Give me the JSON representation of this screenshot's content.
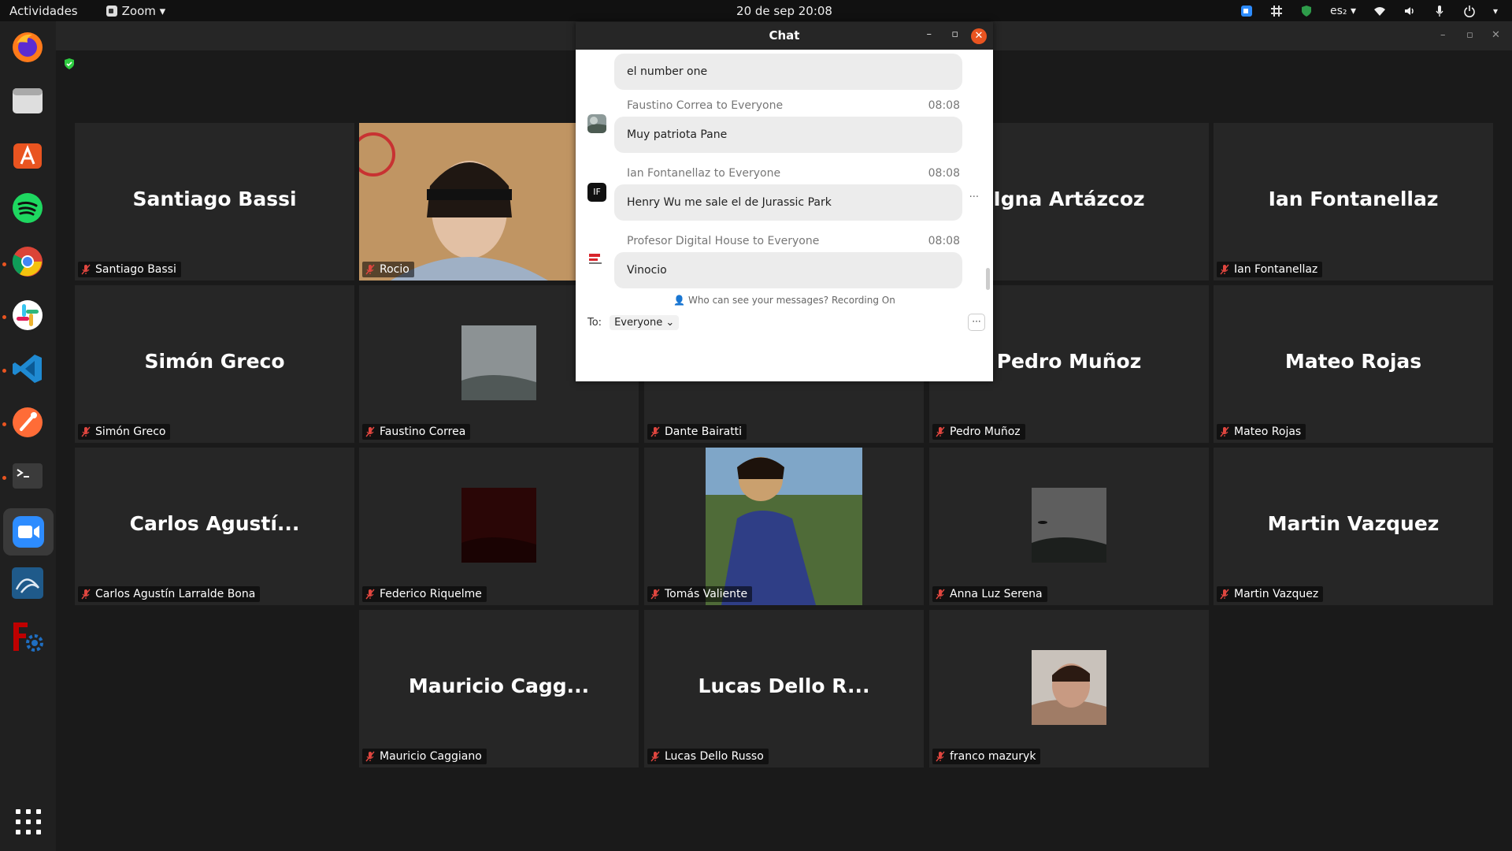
{
  "topbar": {
    "activities": "Actividades",
    "app_menu": "Zoom ▾",
    "clock": "20 de sep  20:08",
    "lang": "es₂ ▾"
  },
  "chat": {
    "title": "Chat",
    "messages": [
      {
        "sender": "",
        "time": "",
        "text": "el number one"
      },
      {
        "sender": "Faustino Correa to Everyone",
        "time": "08:08",
        "text": "Muy patriota Pane"
      },
      {
        "sender": "Ian Fontanellaz to Everyone",
        "time": "08:08",
        "text": "Henry Wu me sale el de Jurassic Park",
        "avatar_initials": "IF"
      },
      {
        "sender": "Profesor Digital House to Everyone",
        "time": "08:08",
        "text": "Vinocio"
      }
    ],
    "notice": "Who can see your messages? Recording On",
    "to_label": "To:",
    "to_value": "Everyone ⌄",
    "more": "···",
    "hover_more": "···"
  },
  "tiles": [
    {
      "big": "Santiago Bassi",
      "label": "Santiago Bassi"
    },
    {
      "big": "",
      "label": "Rocio"
    },
    {
      "big": "",
      "label": ""
    },
    {
      "big": "Igna Artázcoz",
      "label": "ázcoz"
    },
    {
      "big": "Ian Fontanellaz",
      "label": "Ian Fontanellaz"
    },
    {
      "big": "Simón Greco",
      "label": "Simón Greco"
    },
    {
      "big": "",
      "label": "Faustino Correa"
    },
    {
      "big": "",
      "label": "Dante Bairatti"
    },
    {
      "big": "Pedro Muñoz",
      "label": "Pedro Muñoz"
    },
    {
      "big": "Mateo Rojas",
      "label": "Mateo Rojas"
    },
    {
      "big": "Carlos Agustí...",
      "label": "Carlos Agustín Larralde Bona"
    },
    {
      "big": "",
      "label": "Federico Riquelme"
    },
    {
      "big": "",
      "label": "Tomás Valiente"
    },
    {
      "big": "",
      "label": "Anna Luz Serena"
    },
    {
      "big": "Martin Vazquez",
      "label": "Martin Vazquez"
    },
    {
      "big": "Mauricio Cagg...",
      "label": "Mauricio Caggiano"
    },
    {
      "big": "Lucas Dello R...",
      "label": "Lucas Dello Russo"
    },
    {
      "big": "",
      "label": "franco mazuryk"
    }
  ],
  "colors": {
    "accent": "#e95420",
    "tile_bg": "#262626",
    "bg": "#1a1a1a",
    "mic_off": "#e0463f"
  }
}
